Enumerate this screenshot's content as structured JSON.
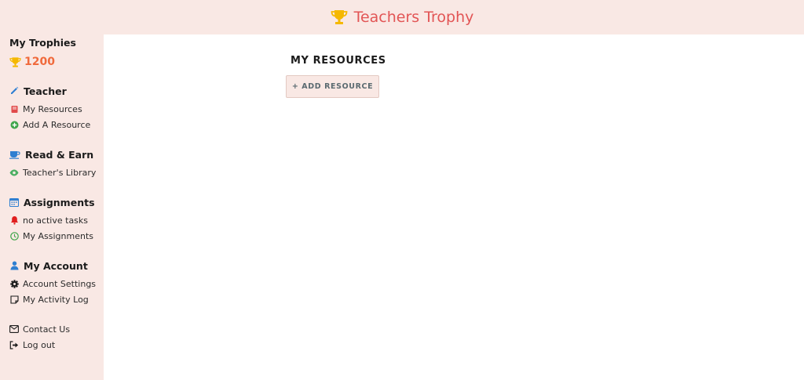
{
  "header": {
    "title": "Teachers Trophy",
    "icon": "trophy-icon"
  },
  "sidebar": {
    "trophies": {
      "heading": "My Trophies",
      "count": "1200"
    },
    "sections": [
      {
        "title": "Teacher",
        "items": [
          "My Resources",
          "Add A Resource"
        ]
      },
      {
        "title": "Read & Earn",
        "items": [
          "Teacher's Library"
        ]
      },
      {
        "title": "Assignments",
        "items": [
          "no active tasks",
          "My Assignments"
        ]
      },
      {
        "title": "My Account",
        "items": [
          "Account Settings",
          "My Activity Log"
        ]
      }
    ],
    "footer": [
      "Contact Us",
      "Log out"
    ]
  },
  "main": {
    "title": "MY RESOURCES",
    "add_button": "+ ADD RESOURCE"
  },
  "colors": {
    "accent": "#e25555",
    "sidebar_bg": "#f9e8e4",
    "trophy": "#f5b800",
    "count": "#f06a3c"
  }
}
